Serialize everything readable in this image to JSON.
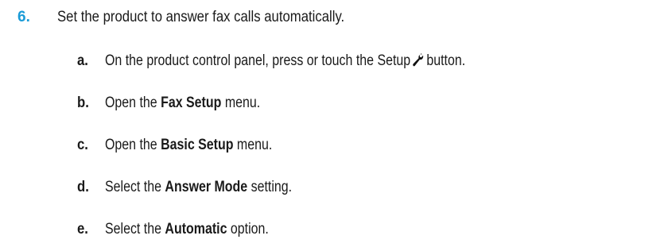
{
  "step": {
    "number": "6.",
    "text": "Set the product to answer fax calls automatically."
  },
  "substeps": [
    {
      "letter": "a.",
      "before": "On the product control panel, press or touch the Setup",
      "icon": "wrench-icon",
      "after": "button."
    },
    {
      "letter": "b.",
      "before": "Open the",
      "bold": "Fax Setup",
      "after": "menu."
    },
    {
      "letter": "c.",
      "before": "Open the",
      "bold": "Basic Setup",
      "after": "menu."
    },
    {
      "letter": "d.",
      "before": "Select the",
      "bold": "Answer Mode",
      "after": "setting."
    },
    {
      "letter": "e.",
      "before": "Select the",
      "bold": "Automatic",
      "after": "option."
    }
  ]
}
